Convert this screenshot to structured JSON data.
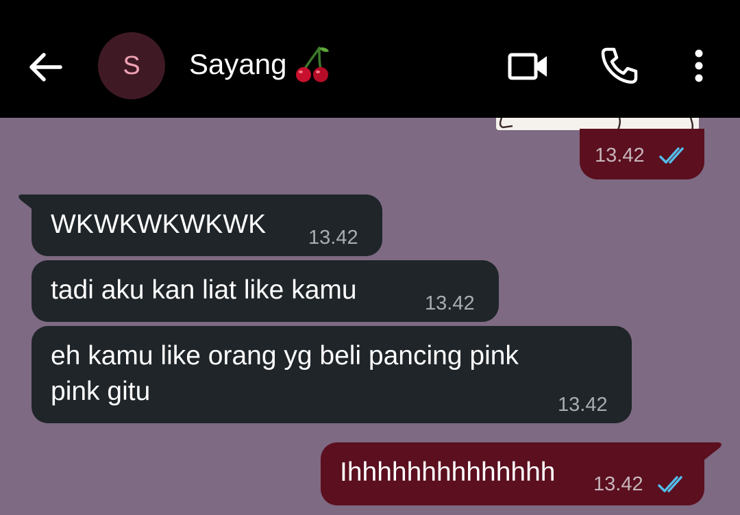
{
  "header": {
    "avatar_letter": "S",
    "contact_name": "Sayang",
    "name_emoji": "cherries-icon"
  },
  "messages": [
    {
      "direction": "outgoing",
      "content": "sticker",
      "time": "13.42",
      "status": "read"
    },
    {
      "direction": "incoming",
      "text": "WKWKWKWKWK",
      "time": "13.42"
    },
    {
      "direction": "incoming",
      "text": "tadi aku kan liat like kamu",
      "time": "13.42"
    },
    {
      "direction": "incoming",
      "text_line1": "eh kamu like orang yg beli pancing pink",
      "text_line2": "pink gitu",
      "time": "13.42"
    },
    {
      "direction": "outgoing",
      "text": "Ihhhhhhhhhhhhhh",
      "time": "13.42",
      "status": "read"
    }
  ],
  "colors": {
    "header_bg": "#000000",
    "chat_bg": "#7e6a82",
    "incoming_bubble": "#1f2529",
    "outgoing_bubble": "#5b0f1f",
    "read_check": "#53bdeb",
    "avatar_bg": "#3f1a24",
    "avatar_letter": "#f0a1b3"
  }
}
